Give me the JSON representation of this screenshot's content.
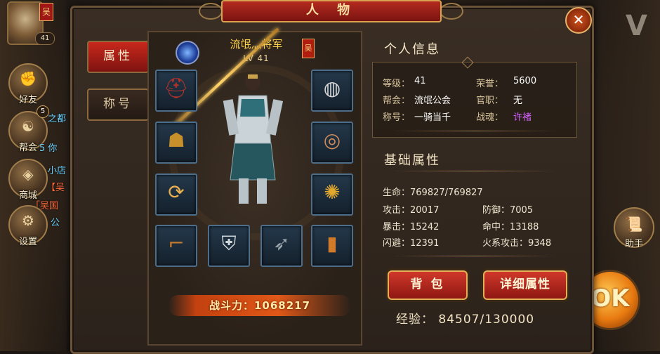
{
  "window": {
    "title": "人 物",
    "close_glyph": "✕"
  },
  "hud": {
    "player_level": "41",
    "portrait_flag": "吴",
    "left_buttons": [
      {
        "label": "好友",
        "icon": "handshake-icon",
        "glyph": "✊"
      },
      {
        "label": "帮会",
        "icon": "guild-icon",
        "glyph": "☯",
        "badge": "5"
      },
      {
        "label": "商城",
        "icon": "shop-icon",
        "glyph": "◈"
      },
      {
        "label": "设置",
        "icon": "gear-icon",
        "glyph": "⚙"
      }
    ],
    "chat_fragments": [
      "之都",
      "5 你",
      "小店",
      "【吴",
      "「吴国",
      "公"
    ],
    "help_label": "助手",
    "ok_label": "OK"
  },
  "tabs": [
    {
      "label": "属性",
      "active": true
    },
    {
      "label": "称号",
      "active": false
    }
  ],
  "character": {
    "name": "流氓灬将军",
    "level": "LV 41",
    "faction_flag": "吴",
    "combat_power_label": "战斗力：1068217",
    "equipment": [
      {
        "slot": "helmet",
        "icon": "helmet-icon",
        "glyph": "⛑"
      },
      {
        "slot": "necklace",
        "icon": "necklace-icon",
        "glyph": "◍"
      },
      {
        "slot": "shoulder",
        "icon": "shoulder-armor-icon",
        "glyph": "☗"
      },
      {
        "slot": "ring",
        "icon": "ring-icon",
        "glyph": "◎"
      },
      {
        "slot": "weapon-charm",
        "icon": "amulet-icon",
        "glyph": "⟳"
      },
      {
        "slot": "pendant",
        "icon": "pendant-icon",
        "glyph": "✺"
      },
      {
        "slot": "boots",
        "icon": "boots-icon",
        "glyph": "⌐"
      },
      {
        "slot": "armor",
        "icon": "armor-icon",
        "glyph": "⛨"
      },
      {
        "slot": "spearhead",
        "icon": "spearhead-icon",
        "glyph": "➶"
      },
      {
        "slot": "bracer",
        "icon": "bracer-icon",
        "glyph": "▮"
      }
    ]
  },
  "personal_info": {
    "title": "个人信息",
    "rows": [
      {
        "k1": "等级：",
        "v1": "41",
        "k2": "荣誉：",
        "v2": "5600"
      },
      {
        "k1": "帮会：",
        "v1": "流氓公会",
        "k2": "官职：",
        "v2": "无"
      },
      {
        "k1": "称号：",
        "v1": "一骑当千",
        "k2": "战魂：",
        "v2": "许褚"
      }
    ]
  },
  "base_attributes": {
    "title": "基础属性",
    "hp": "生命：769827/769827",
    "stats": [
      {
        "left": "攻击：20017",
        "right": "防御：7005"
      },
      {
        "left": "暴击：15242",
        "right": "命中：13188"
      },
      {
        "left": "闪避：12391",
        "right": "火系攻击：9348"
      }
    ]
  },
  "buttons": {
    "bag": "背 包",
    "detail": "详细属性"
  },
  "exp": "经验： 84507/130000",
  "colors": {
    "accent_red": "#c8281c",
    "gold": "#ffd34a",
    "purple": "#d560ff"
  }
}
